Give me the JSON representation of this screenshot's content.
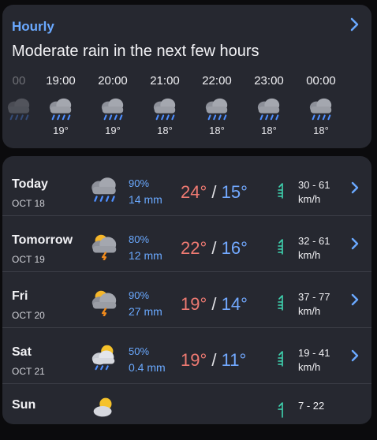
{
  "hourly": {
    "title": "Hourly",
    "summary": "Moderate rain in the next few hours",
    "hours": [
      {
        "time": "00",
        "temp": "",
        "icon": "rain-icon"
      },
      {
        "time": "19:00",
        "temp": "19°",
        "icon": "rain-icon"
      },
      {
        "time": "20:00",
        "temp": "19°",
        "icon": "rain-icon"
      },
      {
        "time": "21:00",
        "temp": "18°",
        "icon": "rain-icon"
      },
      {
        "time": "22:00",
        "temp": "18°",
        "icon": "rain-icon"
      },
      {
        "time": "23:00",
        "temp": "18°",
        "icon": "rain-icon"
      },
      {
        "time": "00:00",
        "temp": "18°",
        "icon": "rain-icon"
      }
    ]
  },
  "daily": [
    {
      "day": "Today",
      "date": "OCT 18",
      "icon": "rain-cloud-icon",
      "precip_pct": "90%",
      "precip_amt": "14 mm",
      "high": "24°",
      "low": "15°",
      "wind_range": "30 - 61",
      "wind_unit": "km/h"
    },
    {
      "day": "Tomorrow",
      "date": "OCT 19",
      "icon": "thunder-sun-cloud-icon",
      "precip_pct": "80%",
      "precip_amt": "12 mm",
      "high": "22°",
      "low": "16°",
      "wind_range": "32 - 61",
      "wind_unit": "km/h"
    },
    {
      "day": "Fri",
      "date": "OCT 20",
      "icon": "thunder-sun-cloud-icon",
      "precip_pct": "90%",
      "precip_amt": "27 mm",
      "high": "19°",
      "low": "14°",
      "wind_range": "37 - 77",
      "wind_unit": "km/h"
    },
    {
      "day": "Sat",
      "date": "OCT 21",
      "icon": "sun-rain-cloud-icon",
      "precip_pct": "50%",
      "precip_amt": "0.4 mm",
      "high": "19°",
      "low": "11°",
      "wind_range": "19 - 41",
      "wind_unit": "km/h"
    },
    {
      "day": "Sun",
      "date": "",
      "icon": "sun-cloud-icon",
      "precip_pct": "",
      "precip_amt": "",
      "high": "",
      "low": "",
      "wind_range": "7 - 22",
      "wind_unit": ""
    }
  ],
  "colors": {
    "accent": "#6aa9ff",
    "high_temp": "#ef7a72",
    "low_temp": "#72a9ff",
    "card": "#262830"
  }
}
